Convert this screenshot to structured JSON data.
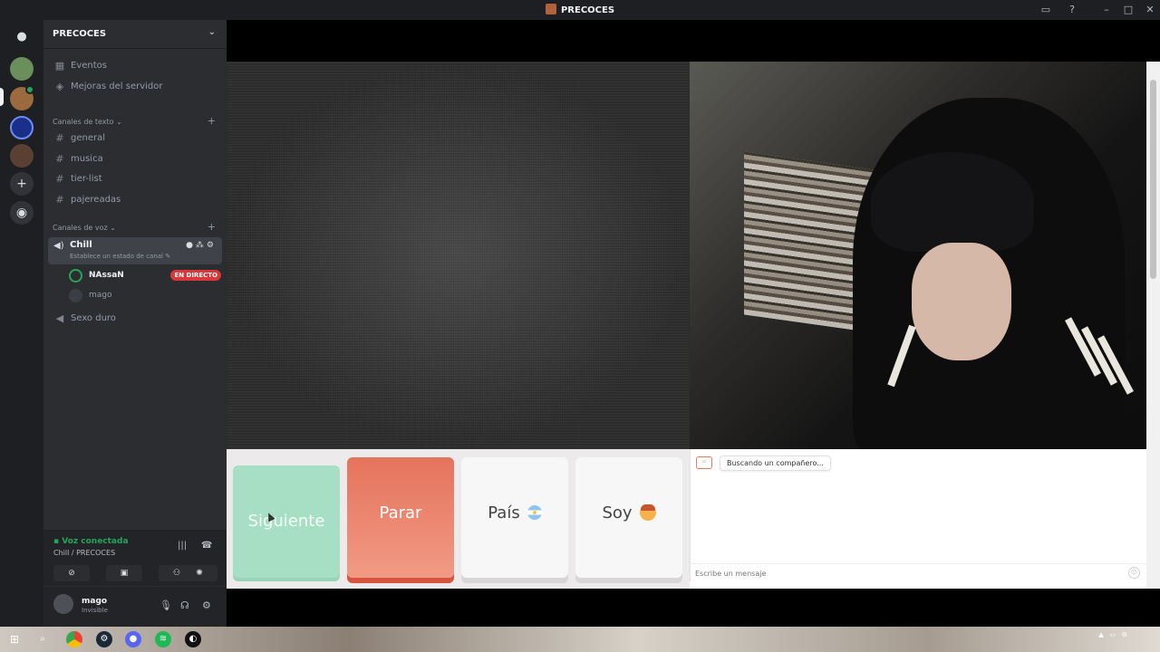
{
  "window": {
    "title": "PRECOCES"
  },
  "guild": {
    "name": "PRECOCES"
  },
  "nav": [
    {
      "label": "Eventos",
      "icon": "calendar-icon"
    },
    {
      "label": "Mejoras del servidor",
      "icon": "boost-icon"
    }
  ],
  "text_category": "Canales de texto",
  "text_channels": [
    "general",
    "musica",
    "tier-list",
    "pajereadas"
  ],
  "voice_category": "Canales de voz",
  "voice_active": {
    "name": "Chill",
    "status_hint": "Establece un estado de canal"
  },
  "voice_users": [
    {
      "name": "NAssaN",
      "badge": "EN DIRECTO"
    },
    {
      "name": "mago"
    }
  ],
  "voice_other": "Sexo duro",
  "voice_bar": {
    "status": "Voz conectada",
    "location": "Chill / PRECOCES"
  },
  "user": {
    "name": "mago",
    "status": "Invisible"
  },
  "omegle": {
    "next": "Siguiente",
    "stop": "Parar",
    "country": "País",
    "soy": "Soy",
    "searching": "Buscando un compañero...",
    "input_placeholder": "Escribe un mensaje"
  },
  "colors": {
    "accent_green": "#23a55a",
    "live_red": "#da373c",
    "next_green": "#a6dfc4",
    "stop_red": "#e5735c"
  }
}
